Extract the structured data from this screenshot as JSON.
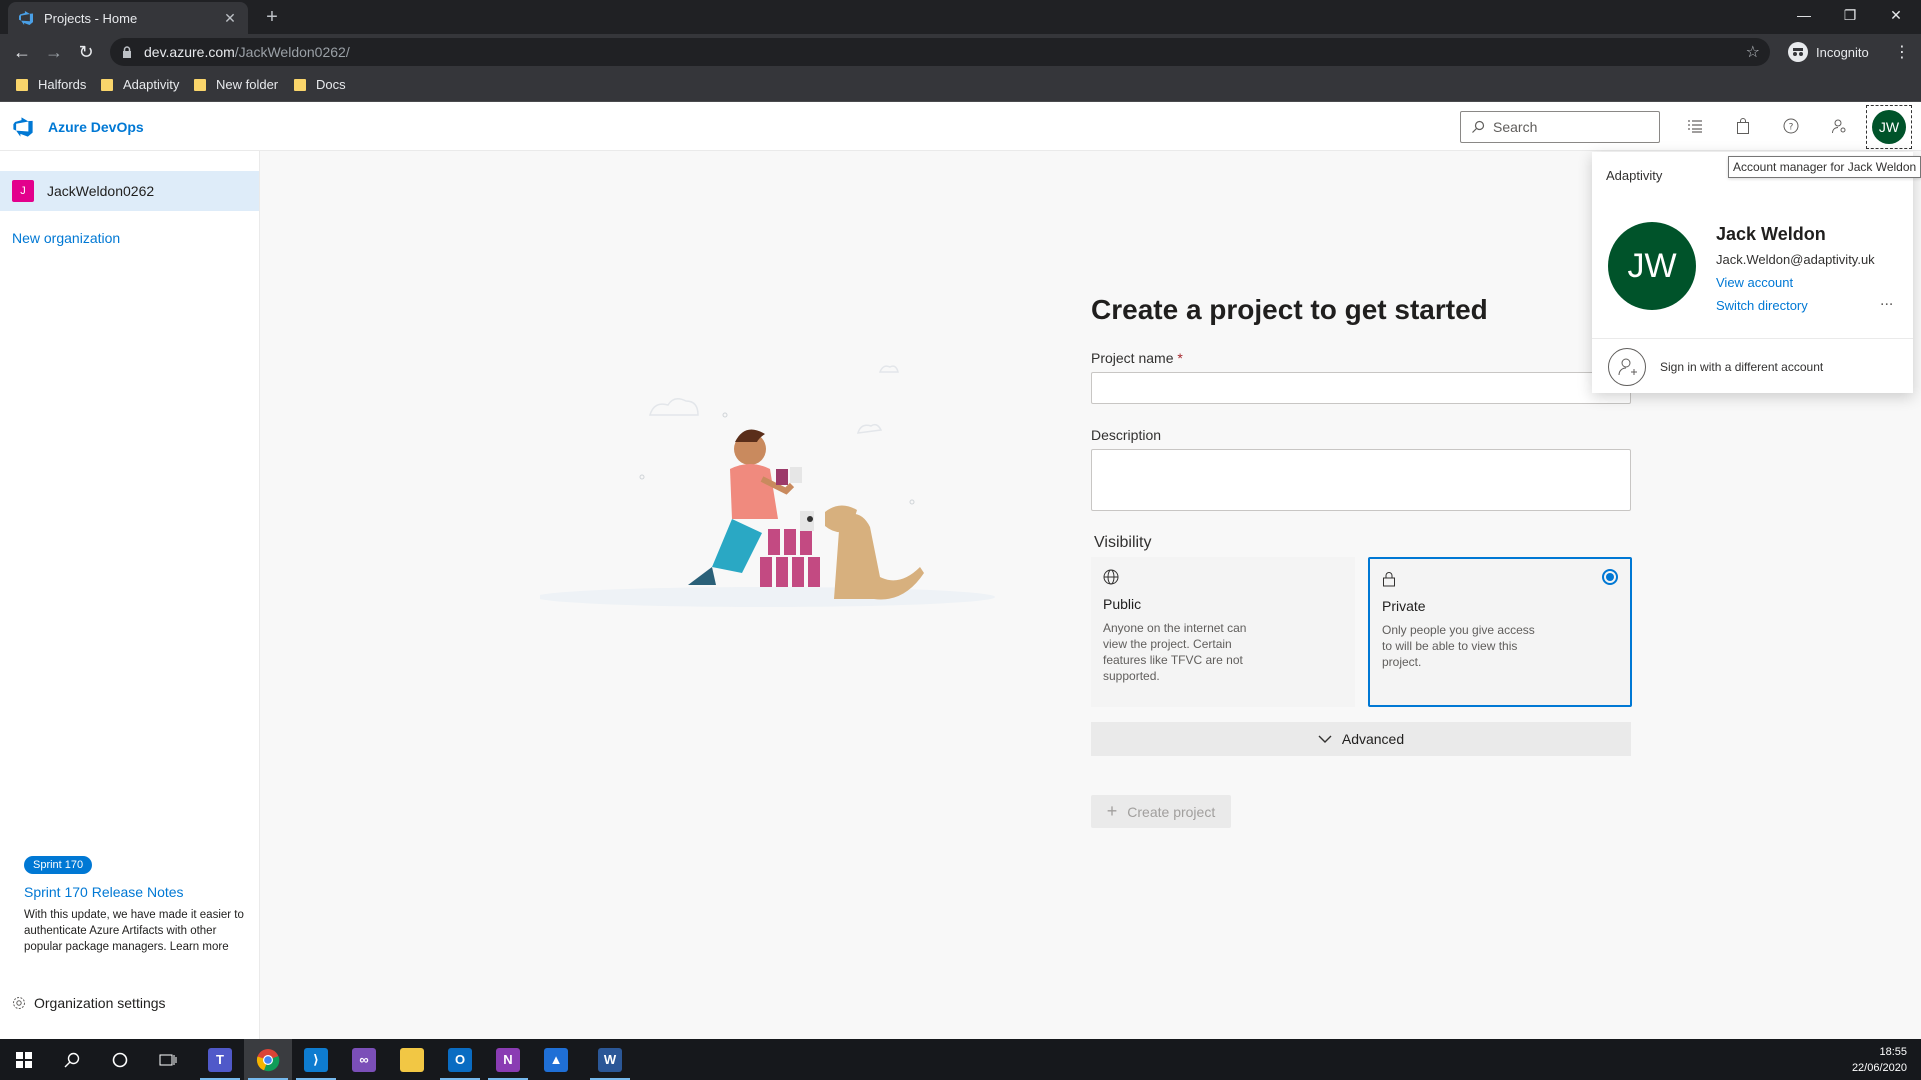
{
  "browser": {
    "tab_title": "Projects - Home",
    "tab_close": "✕",
    "new_tab": "+",
    "url_host": "dev.azure.com",
    "url_path": "/JackWeldon0262/",
    "incognito_label": "Incognito",
    "window_minimize": "—",
    "window_restore": "❐",
    "window_close": "✕",
    "bookmarks": [
      "Halfords",
      "Adaptivity",
      "New folder",
      "Docs"
    ],
    "folder_color": "#f9d56b"
  },
  "header": {
    "product_name": "Azure DevOps",
    "search_placeholder": "Search",
    "avatar_initials": "JW",
    "icons": [
      "list-icon",
      "shopping-bag-icon",
      "help-icon",
      "user-settings-icon"
    ]
  },
  "sidebar": {
    "org_initial": "J",
    "org_name": "JackWeldon0262",
    "new_org_label": "New organization",
    "sprint_badge": "Sprint 170",
    "sprint_title": "Sprint 170 Release Notes",
    "sprint_desc": "With this update, we have made it easier to authenticate Azure Artifacts with other popular package managers.",
    "learn_more": "Learn more",
    "settings_label": "Organization settings"
  },
  "main": {
    "title": "Create a project to get started",
    "project_name_label": "Project name",
    "required_mark": "*",
    "description_label": "Description",
    "visibility_label": "Visibility",
    "visibility": {
      "public": {
        "name": "Public",
        "desc": "Anyone on the internet can view the project. Certain features like TFVC are not supported."
      },
      "private": {
        "name": "Private",
        "desc": "Only people you give access to will be able to view this project.",
        "selected": true
      }
    },
    "advanced_label": "Advanced",
    "create_button": "Create project"
  },
  "account_flyout": {
    "org": "Adaptivity",
    "tooltip": "Account manager for Jack Weldon",
    "initials": "JW",
    "name": "Jack Weldon",
    "email": "Jack.Weldon@adaptivity.uk",
    "view_account": "View account",
    "switch_directory": "Switch directory",
    "more": "...",
    "sign_in_other": "Sign in with a different account"
  },
  "taskbar": {
    "apps": [
      "start-icon",
      "search-icon",
      "cortana-icon",
      "task-view-icon",
      "teams-icon",
      "chrome-icon",
      "vscode-icon",
      "visual-studio-icon",
      "file-explorer-icon",
      "outlook-icon",
      "onenote-icon",
      "azure-data-studio-icon",
      "word-icon"
    ],
    "time": "18:55",
    "date": "22/06/2020"
  },
  "colors": {
    "accent": "#0078d4",
    "avatar_bg": "#00532a",
    "org_badge": "#e3008c"
  }
}
